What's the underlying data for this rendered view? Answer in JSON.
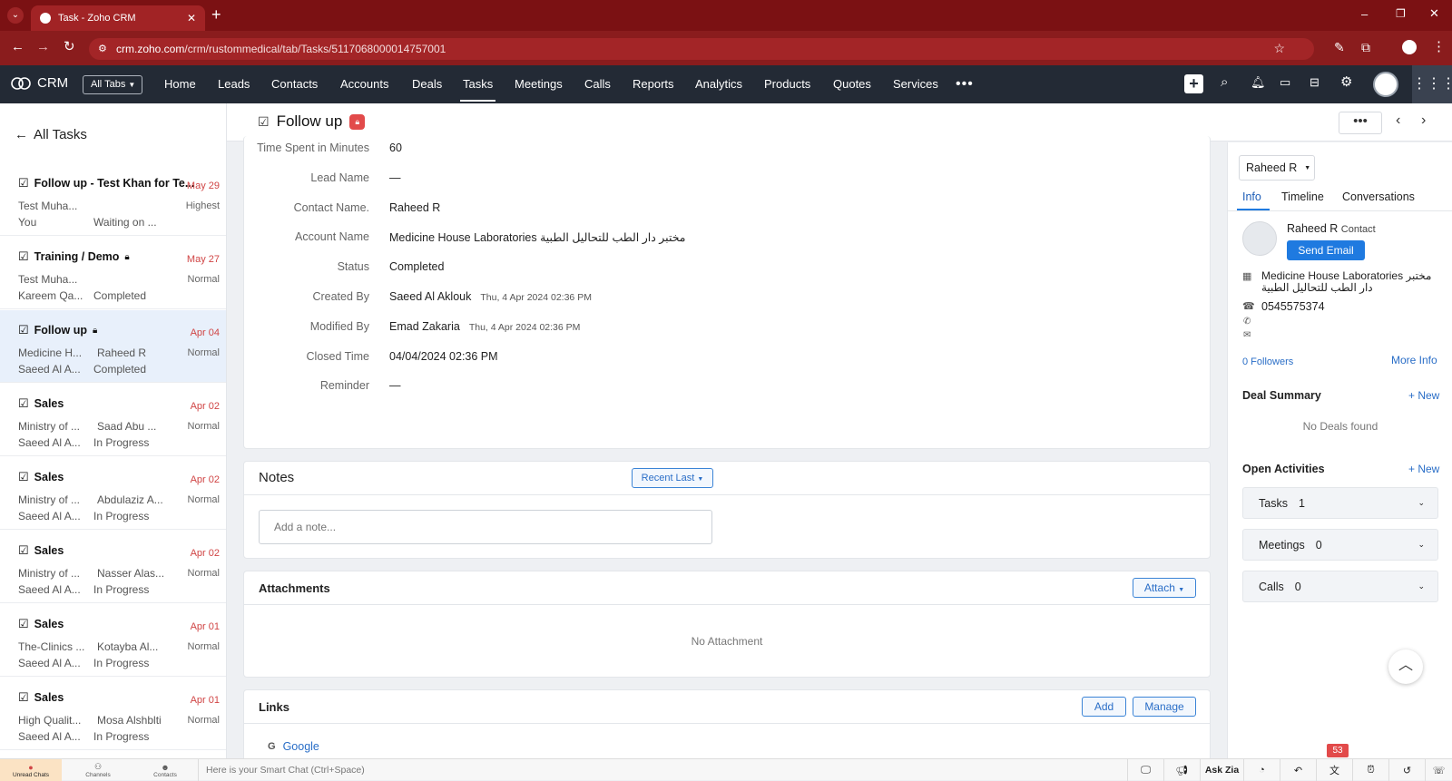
{
  "browser": {
    "tab_title": "Task - Zoho CRM",
    "url_host": "crm.zoho.com",
    "url_path": "/crm/rustommedical/tab/Tasks/5117068000014757001"
  },
  "nav": {
    "brand": "CRM",
    "all_tabs": "All Tabs",
    "items": [
      "Home",
      "Leads",
      "Contacts",
      "Accounts",
      "Deals",
      "Tasks",
      "Meetings",
      "Calls",
      "Reports",
      "Analytics",
      "Products",
      "Quotes",
      "Services"
    ],
    "active": "Tasks"
  },
  "left": {
    "back_label": "All Tasks",
    "tasks": [
      {
        "title": "Follow up - Test Khan for Te...",
        "date": "May 29",
        "c1": "Test Muha...",
        "c2": "",
        "priority": "Highest",
        "c3": "You",
        "c4": "Waiting on ..."
      },
      {
        "title": "Training / Demo",
        "date": "May 27",
        "c1": "Test Muha...",
        "c2": "",
        "priority": "Normal",
        "c3": "Kareem Qa...",
        "c4": "Completed"
      },
      {
        "title": "Follow up",
        "date": "Apr 04",
        "c1": "Medicine H...",
        "c2": "Raheed R",
        "priority": "Normal",
        "c3": "Saeed Al A...",
        "c4": "Completed"
      },
      {
        "title": "Sales",
        "date": "Apr 02",
        "c1": "Ministry of ...",
        "c2": "Saad Abu ...",
        "priority": "Normal",
        "c3": "Saeed Al A...",
        "c4": "In Progress"
      },
      {
        "title": "Sales",
        "date": "Apr 02",
        "c1": "Ministry of ...",
        "c2": "Abdulaziz A...",
        "priority": "Normal",
        "c3": "Saeed Al A...",
        "c4": "In Progress"
      },
      {
        "title": "Sales",
        "date": "Apr 02",
        "c1": "Ministry of ...",
        "c2": "Nasser Alas...",
        "priority": "Normal",
        "c3": "Saeed Al A...",
        "c4": "In Progress"
      },
      {
        "title": "Sales",
        "date": "Apr 01",
        "c1": "The-Clinics ...",
        "c2": "Kotayba Al...",
        "priority": "Normal",
        "c3": "Saeed Al A...",
        "c4": "In Progress"
      },
      {
        "title": "Sales",
        "date": "Apr 01",
        "c1": "High Qualit...",
        "c2": "Mosa Alshblti",
        "priority": "Normal",
        "c3": "Saeed Al A...",
        "c4": "In Progress"
      }
    ]
  },
  "record": {
    "title": "Follow up",
    "fields": [
      {
        "label": "Time Spent in Minutes",
        "value": "60",
        "sub": ""
      },
      {
        "label": "Lead Name",
        "value": "—",
        "sub": ""
      },
      {
        "label": "Contact Name.",
        "value": "Raheed R",
        "sub": ""
      },
      {
        "label": "Account Name",
        "value": "Medicine House Laboratories مختبر دار الطب للتحاليل الطبية",
        "sub": ""
      },
      {
        "label": "Status",
        "value": "Completed",
        "sub": ""
      },
      {
        "label": "Created By",
        "value": "Saeed Al Aklouk",
        "sub": "Thu, 4 Apr 2024 02:36 PM"
      },
      {
        "label": "Modified By",
        "value": "Emad Zakaria",
        "sub": "Thu, 4 Apr 2024 02:36 PM"
      },
      {
        "label": "Closed Time",
        "value": "04/04/2024 02:36 PM",
        "sub": ""
      },
      {
        "label": "Reminder",
        "value": "—",
        "sub": ""
      }
    ]
  },
  "notes": {
    "title": "Notes",
    "sort": "Recent Last",
    "placeholder": "Add a note..."
  },
  "attachments": {
    "title": "Attachments",
    "attach": "Attach",
    "empty": "No Attachment"
  },
  "links": {
    "title": "Links",
    "add": "Add",
    "manage": "Manage",
    "google": "Google"
  },
  "panel": {
    "owner": "Raheed R",
    "tabs": [
      "Info",
      "Timeline",
      "Conversations"
    ],
    "contact_name": "Raheed R",
    "contact_type": "Contact",
    "send_email": "Send Email",
    "account": "Medicine House Laboratories مختبر دار الطب للتحاليل الطبية",
    "phone": "0545575374",
    "followers": "0 Followers",
    "more_info": "More Info",
    "deal_summary": "Deal Summary",
    "new": "+ New",
    "no_deals": "No Deals found",
    "open_activities": "Open Activities",
    "activities": [
      {
        "label": "Tasks",
        "count": "1"
      },
      {
        "label": "Meetings",
        "count": "0"
      },
      {
        "label": "Calls",
        "count": "0"
      }
    ]
  },
  "bottom": {
    "unread": "Unread Chats",
    "channels": "Channels",
    "contacts": "Contacts",
    "smart_chat": "Here is your Smart Chat (Ctrl+Space)",
    "ask_zia": "Ask Zia",
    "badge": "53"
  },
  "colors": {
    "browser": "#8a1c1d",
    "nav": "#232a35",
    "accent": "#1f7ae0",
    "date": "#d04545"
  }
}
